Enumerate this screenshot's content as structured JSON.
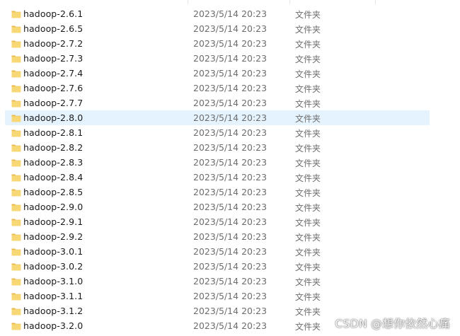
{
  "columns": {
    "name": "",
    "date_modified": "",
    "type": ""
  },
  "hover_row_index": 7,
  "colors": {
    "hover_background": "#e5f3ff",
    "folder_fill": "#f8d775",
    "folder_tab": "#e8b84a",
    "secondary_text": "#6d6d6d"
  },
  "files": [
    {
      "name": "hadoop-2.6.1",
      "modified": "2023/5/14 20:23",
      "type": "文件夹",
      "icon": "folder-icon"
    },
    {
      "name": "hadoop-2.6.5",
      "modified": "2023/5/14 20:23",
      "type": "文件夹",
      "icon": "folder-icon"
    },
    {
      "name": "hadoop-2.7.2",
      "modified": "2023/5/14 20:23",
      "type": "文件夹",
      "icon": "folder-icon"
    },
    {
      "name": "hadoop-2.7.3",
      "modified": "2023/5/14 20:23",
      "type": "文件夹",
      "icon": "folder-icon"
    },
    {
      "name": "hadoop-2.7.4",
      "modified": "2023/5/14 20:23",
      "type": "文件夹",
      "icon": "folder-icon"
    },
    {
      "name": "hadoop-2.7.6",
      "modified": "2023/5/14 20:23",
      "type": "文件夹",
      "icon": "folder-icon"
    },
    {
      "name": "hadoop-2.7.7",
      "modified": "2023/5/14 20:23",
      "type": "文件夹",
      "icon": "folder-icon"
    },
    {
      "name": "hadoop-2.8.0",
      "modified": "2023/5/14 20:23",
      "type": "文件夹",
      "icon": "folder-icon"
    },
    {
      "name": "hadoop-2.8.1",
      "modified": "2023/5/14 20:23",
      "type": "文件夹",
      "icon": "folder-icon"
    },
    {
      "name": "hadoop-2.8.2",
      "modified": "2023/5/14 20:23",
      "type": "文件夹",
      "icon": "folder-icon"
    },
    {
      "name": "hadoop-2.8.3",
      "modified": "2023/5/14 20:23",
      "type": "文件夹",
      "icon": "folder-icon"
    },
    {
      "name": "hadoop-2.8.4",
      "modified": "2023/5/14 20:23",
      "type": "文件夹",
      "icon": "folder-icon"
    },
    {
      "name": "hadoop-2.8.5",
      "modified": "2023/5/14 20:23",
      "type": "文件夹",
      "icon": "folder-icon"
    },
    {
      "name": "hadoop-2.9.0",
      "modified": "2023/5/14 20:23",
      "type": "文件夹",
      "icon": "folder-icon"
    },
    {
      "name": "hadoop-2.9.1",
      "modified": "2023/5/14 20:23",
      "type": "文件夹",
      "icon": "folder-icon"
    },
    {
      "name": "hadoop-2.9.2",
      "modified": "2023/5/14 20:23",
      "type": "文件夹",
      "icon": "folder-icon"
    },
    {
      "name": "hadoop-3.0.1",
      "modified": "2023/5/14 20:23",
      "type": "文件夹",
      "icon": "folder-icon"
    },
    {
      "name": "hadoop-3.0.2",
      "modified": "2023/5/14 20:23",
      "type": "文件夹",
      "icon": "folder-icon"
    },
    {
      "name": "hadoop-3.1.0",
      "modified": "2023/5/14 20:23",
      "type": "文件夹",
      "icon": "folder-icon"
    },
    {
      "name": "hadoop-3.1.1",
      "modified": "2023/5/14 20:23",
      "type": "文件夹",
      "icon": "folder-icon"
    },
    {
      "name": "hadoop-3.1.2",
      "modified": "2023/5/14 20:23",
      "type": "文件夹",
      "icon": "folder-icon"
    },
    {
      "name": "hadoop-3.2.0",
      "modified": "2023/5/14 20:23",
      "type": "文件夹",
      "icon": "folder-icon"
    }
  ],
  "watermark": "CSDN @想你依然心痛"
}
